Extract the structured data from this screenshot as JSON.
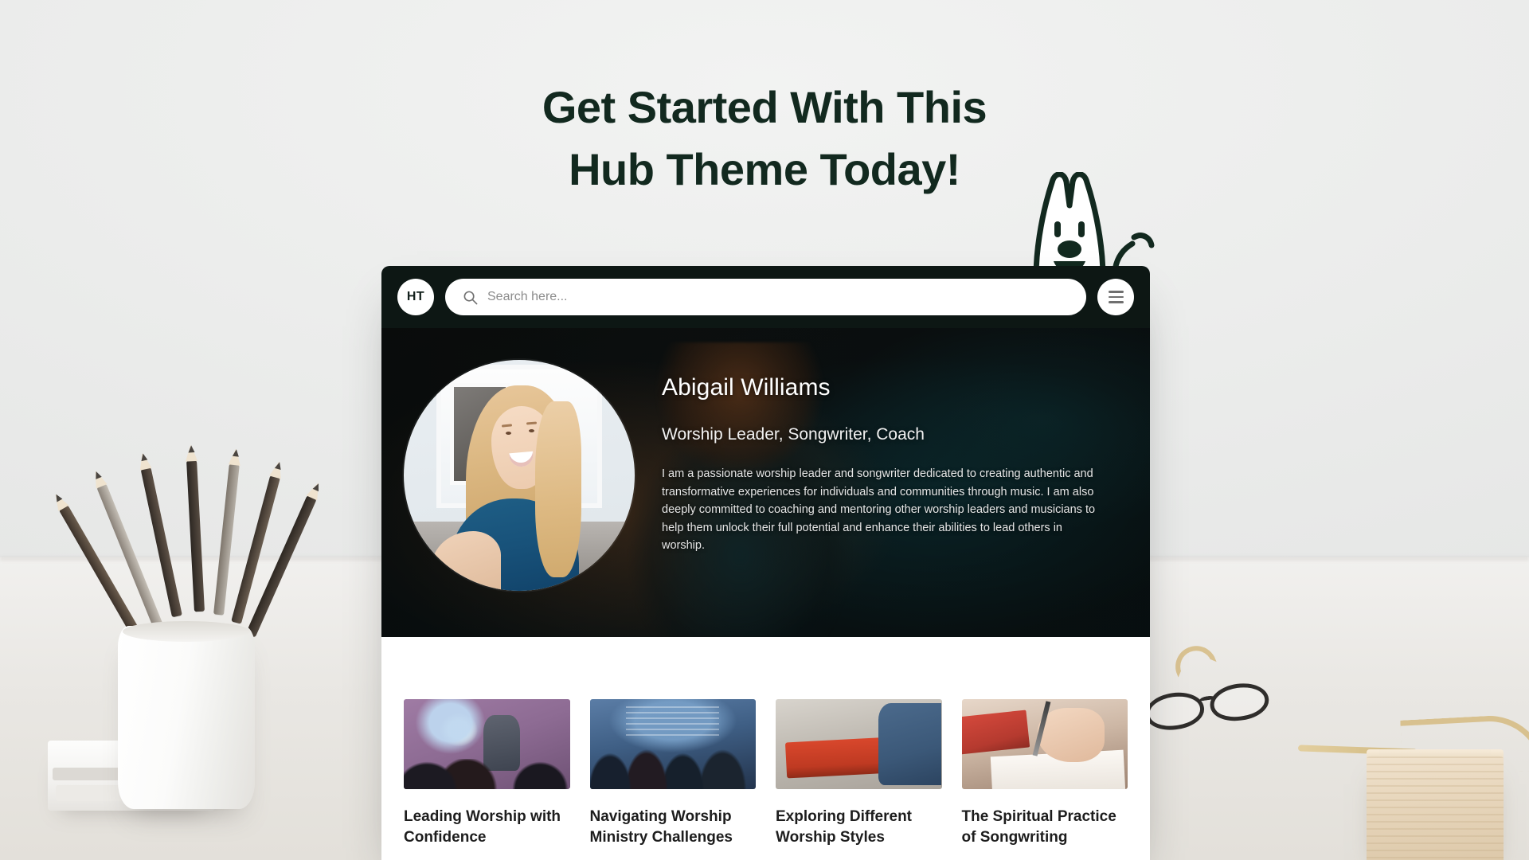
{
  "headline": {
    "line1": "Get Started With This",
    "line2": "Hub Theme Today!",
    "color": "#12291f"
  },
  "browser": {
    "header": {
      "logo_text": "HT",
      "search_placeholder": "Search here...",
      "search_value": "",
      "search_icon": "search-icon",
      "menu_icon": "hamburger-menu-icon",
      "background_color": "#0d1714"
    },
    "hero": {
      "avatar_alt": "Portrait of a smiling blonde woman in a blue top",
      "name": "Abigail Williams",
      "role": "Worship Leader, Songwriter, Coach",
      "bio": "I am a passionate worship leader and songwriter dedicated to creating authentic and transformative experiences for individuals and communities through music. I am also deeply committed to coaching and mentoring other worship leaders and musicians to help them unlock their full potential and enhance their abilities to lead others in worship."
    },
    "articles": [
      {
        "title": "Leading Worship with Confidence",
        "thumb_alt": "Speaker on a purple-lit stage addressing an audience"
      },
      {
        "title": "Navigating Worship Ministry Challenges",
        "thumb_alt": "Congregation with raised hands in front of a blue projector screen"
      },
      {
        "title": "Exploring Different Worship Styles",
        "thumb_alt": "Hands playing a red stage keyboard"
      },
      {
        "title": "The Spiritual Practice of Songwriting",
        "thumb_alt": "Hand writing with a pen on paper beside a red book"
      }
    ]
  },
  "mascot": {
    "name": "bunny-mascot",
    "description": "Line-art bunny character peeking over the top of the browser window with a waving arm"
  },
  "background": {
    "description": "Blurred desk photo: white cup of pencils, books, eyeglasses, light wood block and gold wire object",
    "wall_color": "#ecedec"
  }
}
